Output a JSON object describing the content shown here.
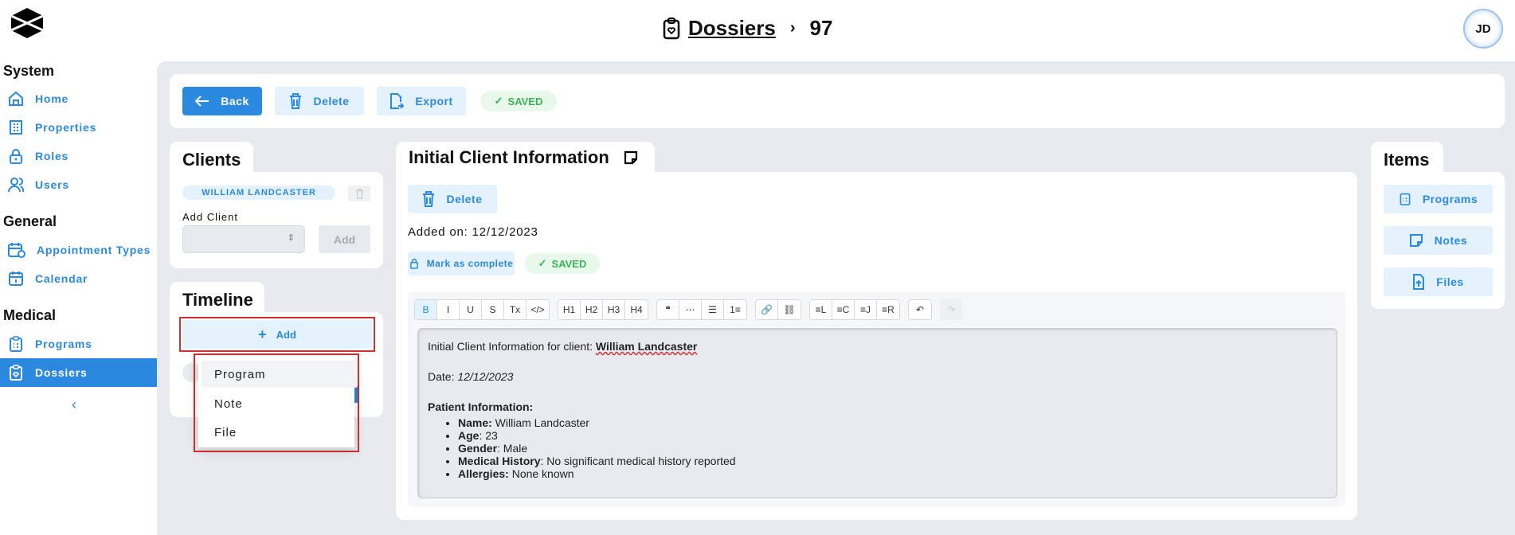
{
  "header": {
    "breadcrumb_root": "Dossiers",
    "breadcrumb_sep": "›",
    "breadcrumb_current": "97",
    "avatar_initials": "JD"
  },
  "sidebar": {
    "sections": [
      {
        "title": "System",
        "items": [
          {
            "label": "Home",
            "icon": "home-icon"
          },
          {
            "label": "Properties",
            "icon": "building-icon"
          },
          {
            "label": "Roles",
            "icon": "lock-icon"
          },
          {
            "label": "Users",
            "icon": "users-icon"
          }
        ]
      },
      {
        "title": "General",
        "items": [
          {
            "label": "Appointment Types",
            "icon": "calendar-clock-icon"
          },
          {
            "label": "Calendar",
            "icon": "calendar-icon"
          }
        ]
      },
      {
        "title": "Medical",
        "items": [
          {
            "label": "Programs",
            "icon": "clipboard-list-icon"
          },
          {
            "label": "Dossiers",
            "icon": "clipboard-heart-icon",
            "active": true
          }
        ]
      }
    ],
    "collapse": "‹"
  },
  "toolbar": {
    "back": "Back",
    "delete": "Delete",
    "export": "Export",
    "saved": "SAVED"
  },
  "clients": {
    "title": "Clients",
    "client_chip": "WILLIAM LANDCASTER",
    "add_client_label": "Add Client",
    "select_value": "",
    "add_button": "Add"
  },
  "timeline": {
    "title": "Timeline",
    "add_button": "Add",
    "menu": [
      "Program",
      "Note",
      "File"
    ]
  },
  "note": {
    "title": "Initial Client Information",
    "delete": "Delete",
    "added_on": "Added on: 12/12/2023",
    "mark_complete": "Mark as complete",
    "saved": "SAVED",
    "editor_toolbar": {
      "groups": [
        [
          "B",
          "I",
          "U",
          "S",
          "Tx",
          "</>"
        ],
        [
          "H1",
          "H2",
          "H3",
          "H4"
        ],
        [
          "❝",
          "⋯",
          "☰",
          "1≡"
        ],
        [
          "🔗",
          "⛓"
        ],
        [
          "≡L",
          "≡C",
          "≡J",
          "≡R"
        ],
        [
          "↶"
        ],
        [
          "↷"
        ]
      ]
    },
    "content": {
      "line1_prefix": "Initial Client Information for client: ",
      "line1_name": "William Landcaster",
      "date_prefix": "Date: ",
      "date_value": "12/12/2023",
      "section": "Patient Information:",
      "list": [
        {
          "label": "Name:",
          "value": " William Landcaster"
        },
        {
          "label": "Age",
          "value": ": 23"
        },
        {
          "label": "Gender",
          "value": ": Male"
        },
        {
          "label": "Medical History",
          "value": ": No significant medical history reported"
        },
        {
          "label": "Allergies:",
          "value": " None known"
        }
      ]
    }
  },
  "items": {
    "title": "Items",
    "buttons": [
      "Programs",
      "Notes",
      "Files"
    ]
  },
  "colors": {
    "accent": "#2b8ae0",
    "accent_light": "#e3f2fd",
    "saved_bg": "#e8f8ea",
    "saved_text": "#3cb35a",
    "background": "#e7eaee",
    "highlight": "#d32f2f"
  }
}
